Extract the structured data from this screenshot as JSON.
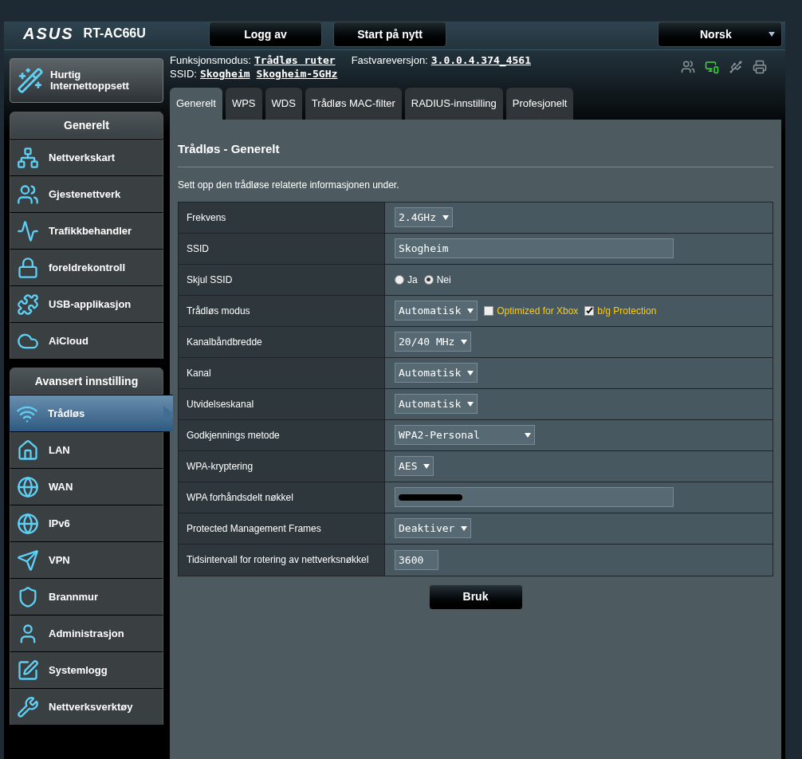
{
  "header": {
    "logo": "ASUS",
    "model": "RT-AC66U",
    "buttons": [
      "Logg av",
      "Start på nytt"
    ],
    "language": "Norsk",
    "mode_label": "Funksjonsmodus:",
    "mode_value": "Trådløs ruter",
    "firmware_label": "Fastvareversjon:",
    "firmware_value": "3.0.0.4.374_4561",
    "ssid_label": "SSID:",
    "ssids": [
      "Skogheim",
      "Skogheim-5GHz"
    ]
  },
  "quick_setup": "Hurtig Internettoppsett",
  "sidebar": [
    {
      "title": "Generelt",
      "items": [
        {
          "label": "Nettverkskart",
          "selected": false
        },
        {
          "label": "Gjestenettverk",
          "selected": false
        },
        {
          "label": "Trafikkbehandler",
          "selected": false
        },
        {
          "label": "foreldrekontroll",
          "selected": false
        },
        {
          "label": "USB-applikasjon",
          "selected": false
        },
        {
          "label": "AiCloud",
          "selected": false
        }
      ]
    },
    {
      "title": "Avansert innstilling",
      "items": [
        {
          "label": "Trådløs",
          "selected": true
        },
        {
          "label": "LAN",
          "selected": false
        },
        {
          "label": "WAN",
          "selected": false
        },
        {
          "label": "IPv6",
          "selected": false
        },
        {
          "label": "VPN",
          "selected": false
        },
        {
          "label": "Brannmur",
          "selected": false
        },
        {
          "label": "Administrasjon",
          "selected": false
        },
        {
          "label": "Systemlogg",
          "selected": false
        },
        {
          "label": "Nettverksverktøy",
          "selected": false
        }
      ]
    }
  ],
  "tabs": [
    {
      "label": "Generelt",
      "selected": true
    },
    {
      "label": "WPS",
      "selected": false
    },
    {
      "label": "WDS",
      "selected": false
    },
    {
      "label": "Trådløs MAC-filter",
      "selected": false
    },
    {
      "label": "RADIUS-innstilling",
      "selected": false
    },
    {
      "label": "Profesjonelt",
      "selected": false
    }
  ],
  "panel": {
    "title": "Trådløs - Generelt",
    "description": "Sett opp den trådløse relaterte informasjonen under.",
    "rows": [
      {
        "label": "Frekvens",
        "kind": "select",
        "value": "2.4GHz"
      },
      {
        "label": "SSID",
        "kind": "text",
        "value": "Skogheim"
      },
      {
        "label": "Skjul SSID",
        "kind": "radio",
        "options": [
          {
            "label": "Ja",
            "selected": false
          },
          {
            "label": "Nei",
            "selected": true
          }
        ]
      },
      {
        "label": "Trådløs modus",
        "kind": "select",
        "value": "Automatisk",
        "checks": [
          {
            "label": "Optimized for Xbox",
            "checked": false
          },
          {
            "label": "b/g Protection",
            "checked": true
          }
        ]
      },
      {
        "label": "Kanalbåndbredde",
        "kind": "select",
        "value": "20/40 MHz"
      },
      {
        "label": "Kanal",
        "kind": "select",
        "value": "Automatisk"
      },
      {
        "label": "Utvidelseskanal",
        "kind": "select",
        "value": "Automatisk"
      },
      {
        "label": "Godkjennings metode",
        "kind": "select",
        "value": "WPA2-Personal"
      },
      {
        "label": "WPA-kryptering",
        "kind": "select",
        "value": "AES"
      },
      {
        "label": "WPA forhåndsdelt nøkkel",
        "kind": "redacted"
      },
      {
        "label": "Protected Management Frames",
        "kind": "select",
        "value": "Deaktiver"
      },
      {
        "label": "Tidsintervall for rotering av nettverksnøkkel",
        "kind": "short",
        "value": "3600"
      }
    ],
    "apply": "Bruk"
  }
}
